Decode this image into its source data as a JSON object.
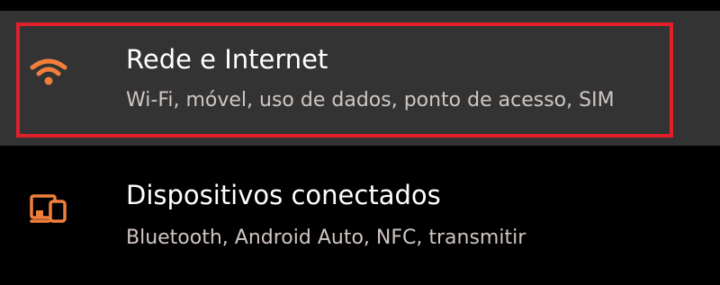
{
  "colors": {
    "accent": "#f07f3c",
    "highlight_border": "#e0202a",
    "selected_row_bg": "#333333",
    "background": "#000000"
  },
  "settings": {
    "items": [
      {
        "title": "Rede e Internet",
        "subtitle": "Wi-Fi, móvel, uso de dados, ponto de acesso, SIM",
        "icon": "wifi-icon"
      },
      {
        "title": "Dispositivos conectados",
        "subtitle": "Bluetooth, Android Auto, NFC, transmitir",
        "icon": "connected-devices-icon"
      }
    ]
  }
}
